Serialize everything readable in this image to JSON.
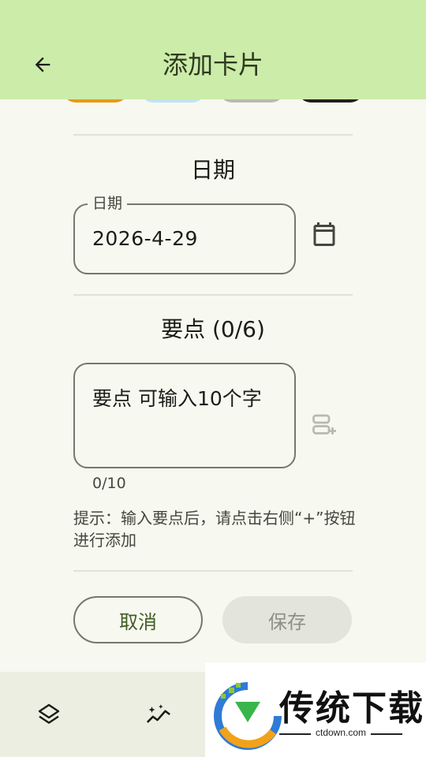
{
  "app_bar": {
    "title": "添加卡片",
    "back_icon": "arrow-back-icon"
  },
  "color_swatches": [
    {
      "color": "#e89a16"
    },
    {
      "color": "#bfe3f3"
    },
    {
      "color": "#b9bab3"
    },
    {
      "color": "#1f201d"
    }
  ],
  "date_section": {
    "title": "日期",
    "field_label": "日期",
    "field_value": "2026-4-29",
    "calendar_icon": "calendar-icon"
  },
  "points_section": {
    "title": "要点 (0/6)",
    "placeholder": "要点 可输入10个字",
    "counter": "0/10",
    "add_icon": "playlist-add-icon",
    "hint": "提示：输入要点后，请点击右侧“+”按钮进行添加"
  },
  "actions": {
    "cancel_label": "取消",
    "save_label": "保存"
  },
  "bottom_nav": [
    {
      "icon": "layers-icon"
    },
    {
      "icon": "sparkle-chart-icon"
    }
  ],
  "watermark": {
    "name": "传统下载",
    "url": "ctdown.com"
  },
  "colors": {
    "app_bar": "#ccecaa",
    "background": "#f7f8f0",
    "primary_text": "#3e5d24"
  }
}
